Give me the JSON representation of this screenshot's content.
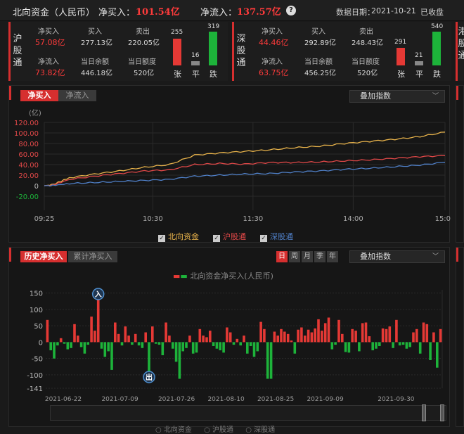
{
  "header": {
    "title": "北向资金（人民币）",
    "net_buy_label": "净买入：",
    "net_buy_value": "101.54亿",
    "net_inflow_label": "净流入：",
    "net_inflow_value": "137.57亿",
    "date_label": "数据日期：",
    "date_value": "2021-10-21",
    "status": "已收盘"
  },
  "sh": {
    "name": "沪股通",
    "net_buy_label": "净买入",
    "net_buy": "57.08亿",
    "buy_label": "买入",
    "buy": "277.13亿",
    "sell_label": "卖出",
    "sell": "220.05亿",
    "net_inflow_label": "净流入",
    "net_inflow": "73.82亿",
    "balance_label": "当日余额",
    "balance": "446.18亿",
    "quota_label": "当日额度",
    "quota": "520亿",
    "up": "255",
    "flat": "16",
    "down": "319",
    "up_label": "张",
    "flat_label": "平",
    "down_label": "跌"
  },
  "sz": {
    "name": "深股通",
    "net_buy_label": "净买入",
    "net_buy": "44.46亿",
    "buy_label": "买入",
    "buy": "292.89亿",
    "sell_label": "卖出",
    "sell": "248.43亿",
    "net_inflow_label": "净流入",
    "net_inflow": "63.75亿",
    "balance_label": "当日余额",
    "balance": "456.25亿",
    "quota_label": "当日额度",
    "quota": "520亿",
    "up": "291",
    "flat": "21",
    "down": "540",
    "up_label": "张",
    "flat_label": "平",
    "down_label": "跌"
  },
  "peek": {
    "name": "港股通"
  },
  "intraday": {
    "tab_active": "净买入",
    "tab_other": "净流入",
    "overlay": "叠加指数",
    "unit": "(亿)",
    "legend": [
      "北向资金",
      "沪股通",
      "深股通"
    ]
  },
  "history": {
    "tab_active": "历史净买入",
    "tab_other": "累计净买入",
    "periods": [
      "日",
      "周",
      "月",
      "季",
      "年"
    ],
    "overlay": "叠加指数",
    "legend_title": "北向资金净买入(人民币)",
    "marker_in": "入",
    "marker_out": "出",
    "bottom_legend": [
      "北向资金",
      "沪股通",
      "深股通"
    ]
  },
  "colors": {
    "up": "#e53935",
    "down": "#1db33a",
    "north": "#e8b34b",
    "sh": "#e04848",
    "sz": "#4f7fc6",
    "accent": "#d62f2f"
  },
  "chart_data": [
    {
      "type": "line",
      "x_ticks": [
        "09:25",
        "10:30",
        "11:30",
        "14:00",
        "15:00"
      ],
      "y_ticks": [
        "120.00",
        "100.00",
        "80.00",
        "60.00",
        "40.00",
        "20.00",
        "0",
        "-20.00"
      ],
      "ylim": [
        -20,
        120
      ],
      "ylabel": "(亿)",
      "series": [
        {
          "name": "北向资金",
          "color": "#e8b34b",
          "x": [
            0,
            5,
            15,
            30,
            45,
            60,
            75,
            90,
            105,
            120,
            135,
            150,
            165,
            180,
            195,
            210,
            225,
            240
          ],
          "y": [
            0,
            2,
            15,
            22,
            28,
            35,
            40,
            58,
            62,
            65,
            68,
            72,
            75,
            80,
            84,
            88,
            93,
            101.54
          ]
        },
        {
          "name": "沪股通",
          "color": "#e04848",
          "x": [
            0,
            5,
            15,
            30,
            45,
            60,
            75,
            90,
            105,
            120,
            135,
            150,
            165,
            180,
            195,
            210,
            225,
            240
          ],
          "y": [
            0,
            1,
            12,
            18,
            23,
            28,
            30,
            40,
            42,
            41,
            44,
            44,
            45,
            47,
            49,
            52,
            55,
            57.08
          ]
        },
        {
          "name": "深股通",
          "color": "#4f7fc6",
          "x": [
            0,
            5,
            15,
            30,
            45,
            60,
            75,
            90,
            105,
            120,
            135,
            150,
            165,
            180,
            195,
            210,
            225,
            240
          ],
          "y": [
            0,
            0.5,
            4,
            6,
            8,
            10,
            12,
            18,
            20,
            22,
            23,
            26,
            28,
            31,
            33,
            36,
            39,
            44.46
          ]
        }
      ]
    },
    {
      "type": "bar",
      "title": "北向资金净买入(人民币)",
      "x_ticks": [
        "2021-06-22",
        "2021-07-09",
        "2021-07-26",
        "2021-08-10",
        "2021-08-25",
        "2021-09-09",
        "2021-09-30"
      ],
      "y_ticks": [
        "150",
        "100",
        "50",
        "0",
        "-50",
        "-100",
        "-141"
      ],
      "ylim": [
        -141,
        160
      ],
      "values": [
        68,
        -25,
        -50,
        -10,
        12,
        -5,
        -22,
        -18,
        55,
        20,
        -15,
        -35,
        -8,
        78,
        35,
        142,
        -20,
        -45,
        -28,
        -85,
        60,
        25,
        -10,
        48,
        20,
        -8,
        25,
        -10,
        -18,
        30,
        -112,
        48,
        -5,
        -8,
        -40,
        60,
        20,
        -20,
        -60,
        -112,
        -28,
        -18,
        20,
        -35,
        -32,
        40,
        20,
        15,
        35,
        -12,
        -20,
        -25,
        -32,
        45,
        30,
        -8,
        10,
        -10,
        20,
        -35,
        -12,
        -45,
        -28,
        62,
        40,
        -112,
        -112,
        32,
        20,
        40,
        32,
        25,
        5,
        -35,
        38,
        45,
        20,
        38,
        30,
        42,
        70,
        35,
        58,
        75,
        -22,
        -8,
        68,
        25,
        -30,
        -32,
        40,
        35,
        -28,
        58,
        60,
        18,
        -25,
        -20,
        -12,
        42,
        40,
        48,
        -18,
        68,
        -10,
        -8,
        -20,
        -15,
        30,
        40,
        -35,
        60,
        55,
        -55,
        30,
        -78,
        40
      ]
    }
  ]
}
